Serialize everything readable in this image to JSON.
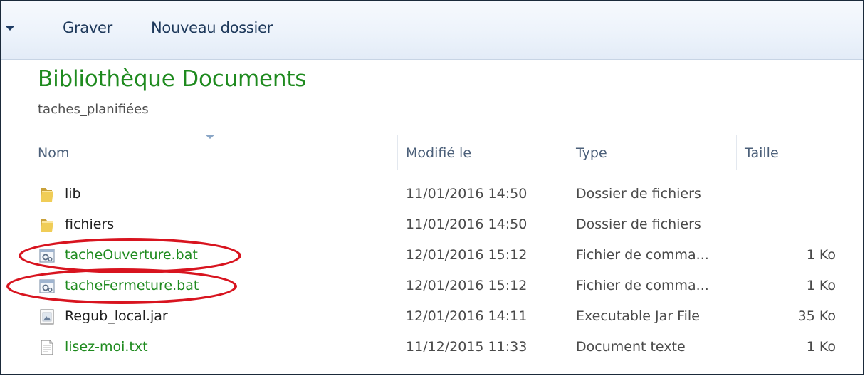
{
  "toolbar": {
    "burn_label": "Graver",
    "new_folder_label": "Nouveau dossier"
  },
  "library": {
    "title": "Bibliothèque Documents",
    "subfolder": "taches_planifiées"
  },
  "columns": {
    "name": "Nom",
    "modified": "Modifié le",
    "type": "Type",
    "size": "Taille"
  },
  "files": [
    {
      "name": "lib",
      "modified": "11/01/2016 14:50",
      "type": "Dossier de fichiers",
      "size": "",
      "icon": "folder-icon",
      "highlighted": false
    },
    {
      "name": "fichiers",
      "modified": "11/01/2016 14:50",
      "type": "Dossier de fichiers",
      "size": "",
      "icon": "folder-icon",
      "highlighted": false
    },
    {
      "name": "tacheOuverture.bat",
      "modified": "12/01/2016 15:12",
      "type": "Fichier de comma...",
      "size": "1 Ko",
      "icon": "batch-file-icon",
      "highlighted": true
    },
    {
      "name": "tacheFermeture.bat",
      "modified": "12/01/2016 15:12",
      "type": "Fichier de comma...",
      "size": "1 Ko",
      "icon": "batch-file-icon",
      "highlighted": true
    },
    {
      "name": "Regub_local.jar",
      "modified": "12/01/2016 14:11",
      "type": "Executable Jar File",
      "size": "35 Ko",
      "icon": "jar-file-icon",
      "highlighted": false
    },
    {
      "name": "lisez-moi.txt",
      "modified": "11/12/2015 11:33",
      "type": "Document texte",
      "size": "1 Ko",
      "icon": "text-file-icon",
      "highlighted": false
    }
  ],
  "colors": {
    "library_title": "#1e8a1e",
    "highlight_ring": "#d8141f",
    "toolbar_text": "#1e395b"
  }
}
